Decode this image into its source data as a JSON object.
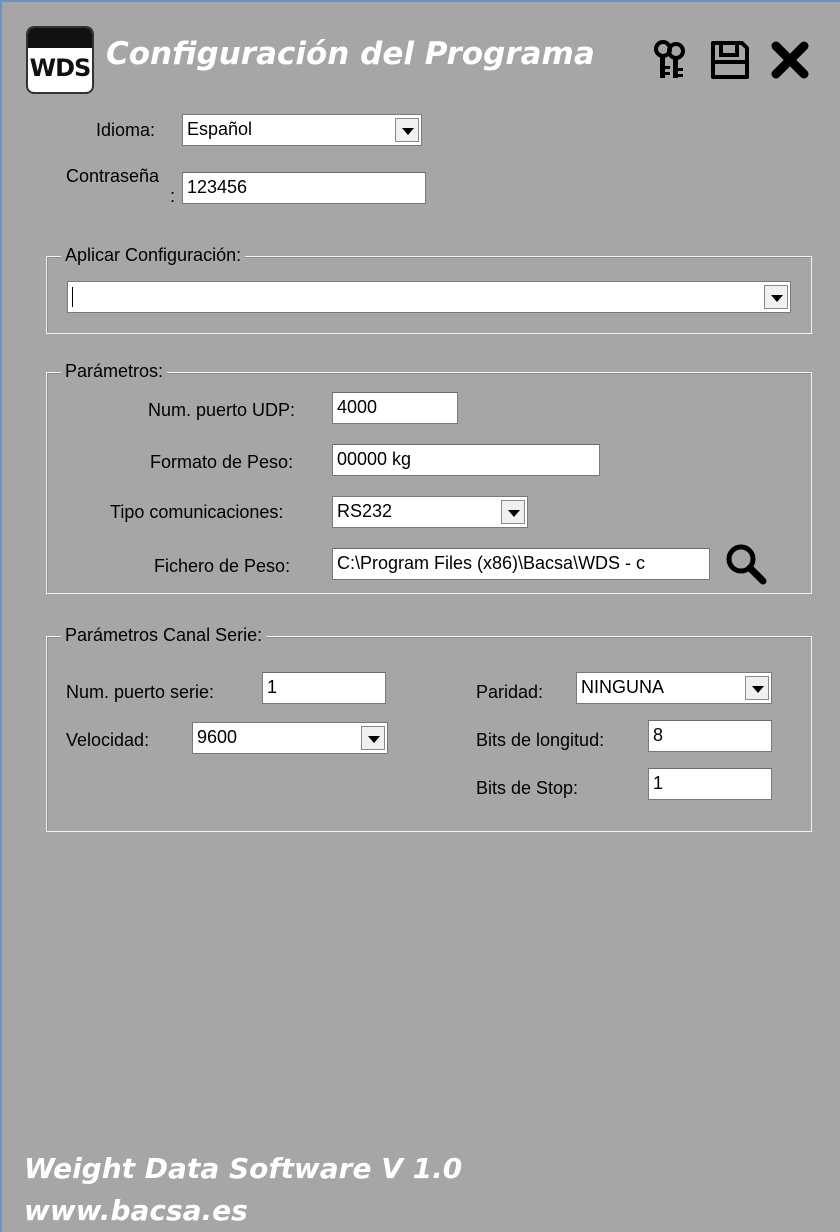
{
  "header": {
    "logo_text": "WDS",
    "title": "Configuración del Programa",
    "icons": [
      "keys-icon",
      "save-icon",
      "close-icon"
    ]
  },
  "general": {
    "language_label": "Idioma:",
    "language_value": "Español",
    "password_label": "Contraseña",
    "password_colon": ":",
    "password_value": "123456"
  },
  "apply_config": {
    "legend": "Aplicar Configuración:",
    "value": ""
  },
  "parameters": {
    "legend": "Parámetros:",
    "udp_port_label": "Num. puerto UDP:",
    "udp_port_value": "4000",
    "weight_format_label": "Formato de Peso:",
    "weight_format_value": "00000 kg",
    "comm_type_label": "Tipo comunicaciones:",
    "comm_type_value": "RS232",
    "weight_file_label": "Fichero de Peso:",
    "weight_file_value": "C:\\Program Files (x86)\\Bacsa\\WDS - c"
  },
  "serial": {
    "legend": "Parámetros Canal Serie:",
    "port_label": "Num. puerto serie:",
    "port_value": "1",
    "speed_label": "Velocidad:",
    "speed_value": "9600",
    "parity_label": "Paridad:",
    "parity_value": "NINGUNA",
    "length_bits_label": "Bits de longitud:",
    "length_bits_value": "8",
    "stop_bits_label": "Bits de Stop:",
    "stop_bits_value": "1"
  },
  "footer": {
    "product": "Weight Data Software V 1.0",
    "website": "www.bacsa.es"
  },
  "colors": {
    "background": "#a6a6a6",
    "title_text": "#ffffff",
    "window_border": "#6f92c0"
  }
}
